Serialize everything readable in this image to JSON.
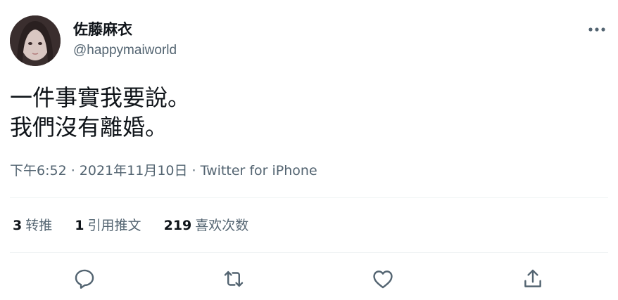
{
  "user": {
    "display_name": "佐藤麻衣",
    "handle": "@happymaiworld",
    "avatar_icon": "profile-photo"
  },
  "tweet": {
    "lines": [
      "一件事實我要說。",
      "我們沒有離婚。"
    ]
  },
  "meta": {
    "time": "下午6:52",
    "separator1": " · ",
    "date": "2021年11月10日",
    "separator2": " · ",
    "source": "Twitter for iPhone"
  },
  "stats": {
    "retweets": {
      "count": "3",
      "label": "转推"
    },
    "quotes": {
      "count": "1",
      "label": "引用推文"
    },
    "likes": {
      "count": "219",
      "label": "喜欢次数"
    }
  },
  "actions": [
    "reply-icon",
    "retweet-icon",
    "like-icon",
    "share-icon"
  ],
  "colors": {
    "text_primary": "#0f1419",
    "text_secondary": "#536471",
    "divider": "#eff3f4"
  }
}
